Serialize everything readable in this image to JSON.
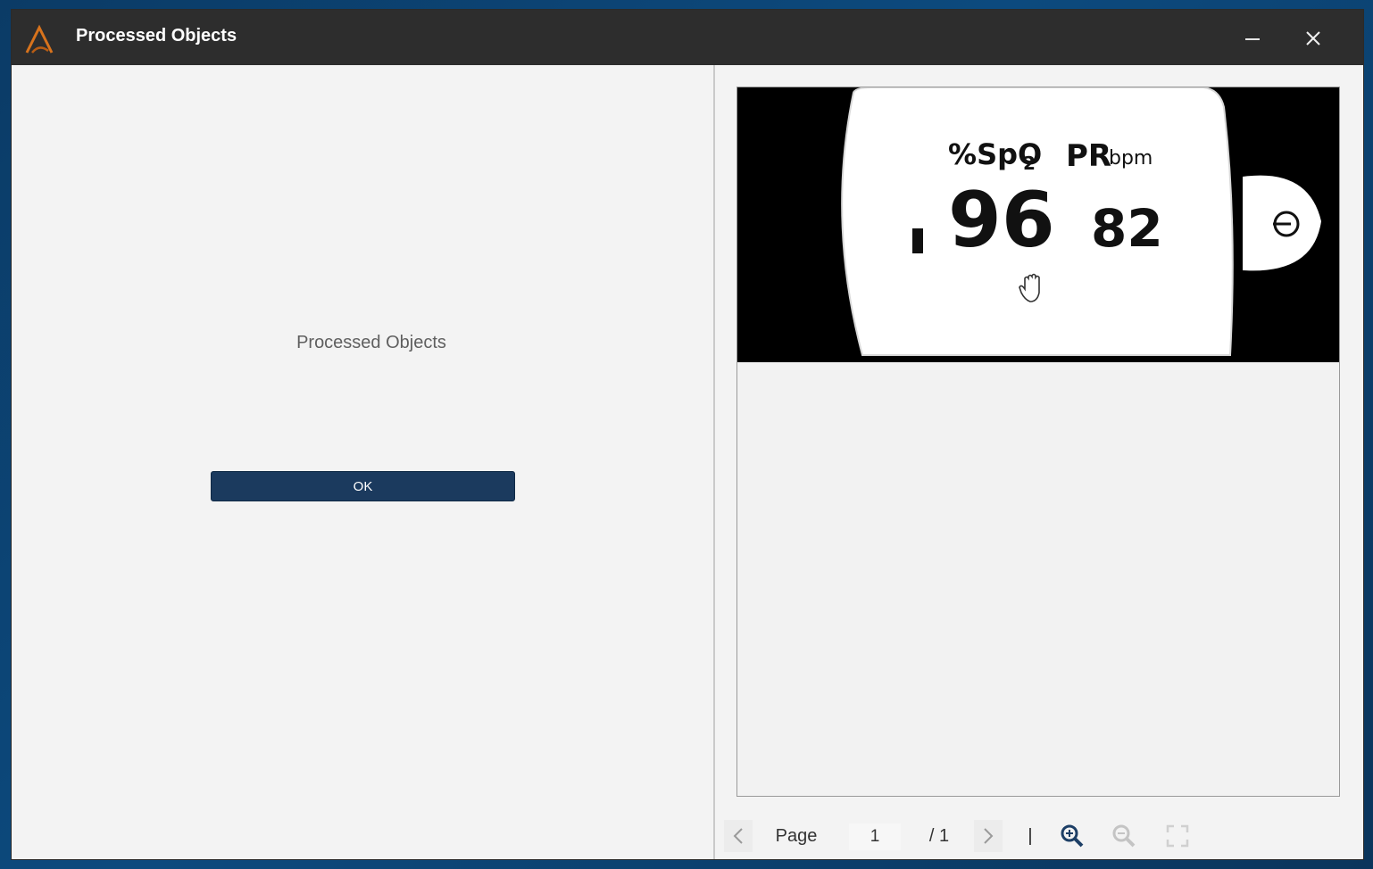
{
  "window": {
    "title": "Processed Objects",
    "minimize_icon": "minimize-icon",
    "close_icon": "close-icon",
    "app_icon": "app-logo-a-icon",
    "accent": "#e07a1f"
  },
  "dialog": {
    "message": "Processed Objects",
    "ok_label": "OK",
    "ok_color": "#1b3a5e"
  },
  "viewer": {
    "preview_readout": {
      "spo2_label": "%SpO",
      "spo2_subscript": "2",
      "pr_label": "PR",
      "pr_unit": "bpm",
      "spo2_value": "96",
      "pr_value": "82"
    },
    "toolbar": {
      "prev_icon": "chevron-left-icon",
      "page_label": "Page",
      "page_value": "1",
      "page_total": "/ 1",
      "next_icon": "chevron-right-icon",
      "separator": "|",
      "zoom_in_icon": "zoom-in-icon",
      "zoom_out_icon": "zoom-out-icon",
      "fit_icon": "fit-page-icon"
    }
  }
}
